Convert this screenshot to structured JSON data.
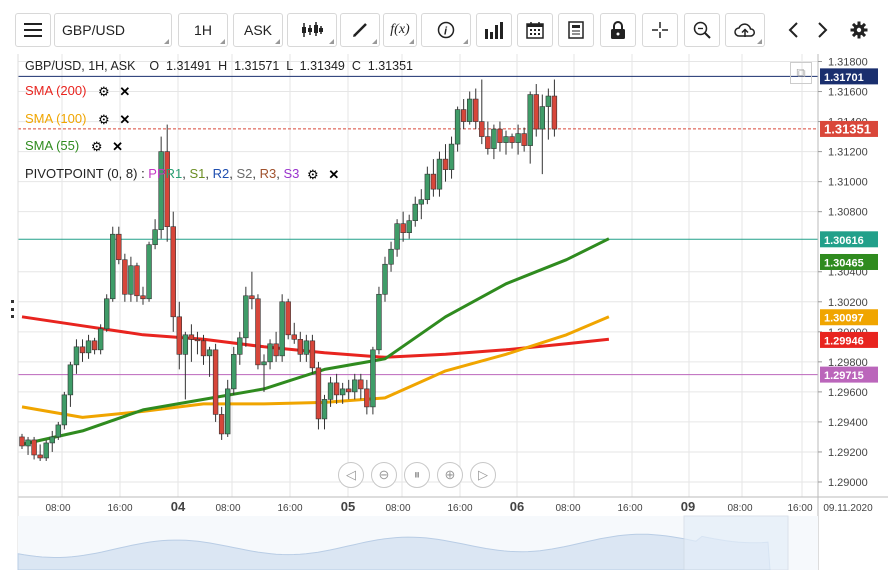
{
  "toolbar": {
    "menu_icon": "hamburger-menu-icon",
    "symbol": "GBP/USD",
    "timeframe": "1H",
    "price_type": "ASK",
    "tools": [
      "candlestick-icon",
      "draw-icon",
      "function-icon",
      "info-icon",
      "volume-bars-icon",
      "calendar-icon",
      "news-icon",
      "lock-icon",
      "crosshair-icon",
      "zoom-icon",
      "cloud-upload-icon",
      "arrow-left-icon",
      "arrow-right-icon",
      "settings-gear-icon"
    ],
    "fx_label": "f(x)"
  },
  "ohlc_header": "GBP/USD, 1H, ASK    O  1.31491  H  1.31571  L  1.31349  C  1.31351",
  "indicators": [
    {
      "label": "SMA (200)",
      "color": "#e8241f"
    },
    {
      "label": "SMA (100)",
      "color": "#f0a500"
    },
    {
      "label": "SMA (55)",
      "color": "#2f8b1f"
    }
  ],
  "pivot": {
    "label": "PIVOTPOINT (0, 8)",
    "sep": " : ",
    "parts": [
      {
        "t": "PP",
        "c": "#c438c4"
      },
      {
        "t": "R1",
        "c": "#2a9f73"
      },
      {
        "t": ", ",
        "c": "#333333"
      },
      {
        "t": "S1",
        "c": "#6b8e23"
      },
      {
        "t": ", ",
        "c": "#333333"
      },
      {
        "t": "R2",
        "c": "#1f4fb0"
      },
      {
        "t": ", ",
        "c": "#333333"
      },
      {
        "t": "S2",
        "c": "#6b6b6b"
      },
      {
        "t": ", ",
        "c": "#333333"
      },
      {
        "t": "R3",
        "c": "#a0522d"
      },
      {
        "t": ", ",
        "c": "#333333"
      },
      {
        "t": "S3",
        "c": "#9932cc"
      }
    ]
  },
  "price_axis": {
    "ticks": [
      "1.31800",
      "1.31600",
      "1.31400",
      "1.31200",
      "1.31000",
      "1.30800",
      "1.30400",
      "1.30200",
      "1.30000",
      "1.29800",
      "1.29600",
      "1.29400",
      "1.29200",
      "1.29000"
    ],
    "tick_values": [
      1.318,
      1.316,
      1.314,
      1.312,
      1.31,
      1.308,
      1.304,
      1.302,
      1.3,
      1.298,
      1.296,
      1.294,
      1.292,
      1.29
    ],
    "labels": [
      {
        "text": "1.31701",
        "value": 1.31701,
        "bg": "#1a2f6e"
      },
      {
        "text": "1.31351",
        "value": 1.31351,
        "bg": "#d9473a"
      },
      {
        "text": "1.30616",
        "value": 1.30616,
        "bg": "#22a08a"
      },
      {
        "text": "1.30465",
        "value": 1.30465,
        "bg": "#2f8b1f"
      },
      {
        "text": "1.30097",
        "value": 1.30097,
        "bg": "#f0a500"
      },
      {
        "text": "1.29946",
        "value": 1.29946,
        "bg": "#e8241f"
      },
      {
        "text": "1.29715",
        "value": 1.29715,
        "bg": "#bb66bb"
      }
    ]
  },
  "time_axis": [
    {
      "text": "08:00",
      "bold": false
    },
    {
      "text": "16:00",
      "bold": false
    },
    {
      "text": "04",
      "bold": true
    },
    {
      "text": "08:00",
      "bold": false
    },
    {
      "text": "16:00",
      "bold": false
    },
    {
      "text": "05",
      "bold": true
    },
    {
      "text": "08:00",
      "bold": false
    },
    {
      "text": "16:00",
      "bold": false
    },
    {
      "text": "06",
      "bold": true
    },
    {
      "text": "08:00",
      "bold": false
    },
    {
      "text": "16:00",
      "bold": false
    },
    {
      "text": "09",
      "bold": true
    },
    {
      "text": "08:00",
      "bold": false
    },
    {
      "text": "16:00",
      "bold": false
    },
    {
      "text": "09.11.2020",
      "bold": false
    }
  ],
  "nav_buttons": [
    "scroll-left-icon",
    "zoom-out-icon",
    "reset-zoom-icon",
    "zoom-in-icon",
    "scroll-right-icon"
  ],
  "chart_data": {
    "type": "candlestick",
    "symbol": "GBP/USD",
    "interval": "1H",
    "ylim": [
      1.289,
      1.3185
    ],
    "hlines": [
      {
        "value": 1.31701,
        "color": "#1a2f6e"
      },
      {
        "value": 1.31351,
        "color": "#d9473a"
      },
      {
        "value": 1.30616,
        "color": "#22a08a"
      },
      {
        "value": 1.29715,
        "color": "#bb66bb"
      }
    ],
    "candles": [
      [
        1.293,
        1.2932,
        1.2922,
        1.2924
      ],
      [
        1.2924,
        1.293,
        1.2918,
        1.2928
      ],
      [
        1.2928,
        1.293,
        1.2915,
        1.2918
      ],
      [
        1.2918,
        1.2925,
        1.2914,
        1.2916
      ],
      [
        1.2916,
        1.2928,
        1.2914,
        1.2926
      ],
      [
        1.2926,
        1.2934,
        1.292,
        1.293
      ],
      [
        1.293,
        1.294,
        1.2928,
        1.2938
      ],
      [
        1.2938,
        1.296,
        1.2935,
        1.2958
      ],
      [
        1.2958,
        1.298,
        1.295,
        1.2978
      ],
      [
        1.2978,
        1.2995,
        1.2972,
        1.299
      ],
      [
        1.299,
        1.2995,
        1.298,
        1.2986
      ],
      [
        1.2986,
        1.2998,
        1.2982,
        1.2994
      ],
      [
        1.2994,
        1.2996,
        1.2985,
        1.2988
      ],
      [
        1.2988,
        1.3005,
        1.2985,
        1.3002
      ],
      [
        1.3002,
        1.3025,
        1.3,
        1.3022
      ],
      [
        1.3022,
        1.307,
        1.302,
        1.3065
      ],
      [
        1.3065,
        1.307,
        1.3045,
        1.3048
      ],
      [
        1.3048,
        1.3052,
        1.302,
        1.3025
      ],
      [
        1.3025,
        1.305,
        1.302,
        1.3044
      ],
      [
        1.3044,
        1.3046,
        1.302,
        1.3024
      ],
      [
        1.3024,
        1.303,
        1.3018,
        1.3022
      ],
      [
        1.3022,
        1.306,
        1.302,
        1.3058
      ],
      [
        1.3058,
        1.3075,
        1.3055,
        1.3068
      ],
      [
        1.3068,
        1.313,
        1.3062,
        1.312
      ],
      [
        1.312,
        1.3138,
        1.306,
        1.307
      ],
      [
        1.307,
        1.308,
        1.3,
        1.301
      ],
      [
        1.301,
        1.302,
        1.2975,
        1.2985
      ],
      [
        1.2985,
        1.3,
        1.2955,
        1.2998
      ],
      [
        1.2998,
        1.3005,
        1.298,
        1.2995
      ],
      [
        1.2995,
        1.3,
        1.2985,
        1.2994
      ],
      [
        1.2994,
        1.2998,
        1.2978,
        1.2984
      ],
      [
        1.2984,
        1.299,
        1.297,
        1.2988
      ],
      [
        1.2988,
        1.2992,
        1.294,
        1.2945
      ],
      [
        1.2945,
        1.295,
        1.2928,
        1.2932
      ],
      [
        1.2932,
        1.2968,
        1.293,
        1.2962
      ],
      [
        1.2962,
        1.299,
        1.2958,
        1.2985
      ],
      [
        1.2985,
        1.3,
        1.2978,
        1.2996
      ],
      [
        1.2996,
        1.303,
        1.299,
        1.3024
      ],
      [
        1.3024,
        1.304,
        1.3015,
        1.3022
      ],
      [
        1.3022,
        1.3025,
        1.2975,
        1.2978
      ],
      [
        1.2978,
        1.2985,
        1.296,
        1.298
      ],
      [
        1.298,
        1.2995,
        1.2975,
        1.2992
      ],
      [
        1.2992,
        1.3,
        1.298,
        1.2984
      ],
      [
        1.2984,
        1.3025,
        1.298,
        1.302
      ],
      [
        1.302,
        1.3022,
        1.2995,
        1.2998
      ],
      [
        1.2998,
        1.3006,
        1.2992,
        1.2995
      ],
      [
        1.2995,
        1.3,
        1.298,
        1.2985
      ],
      [
        1.2985,
        1.2998,
        1.298,
        1.2994
      ],
      [
        1.2994,
        1.2998,
        1.2972,
        1.2976
      ],
      [
        1.2976,
        1.298,
        1.2935,
        1.2942
      ],
      [
        1.2942,
        1.2958,
        1.2935,
        1.2955
      ],
      [
        1.2955,
        1.297,
        1.295,
        1.2966
      ],
      [
        1.2966,
        1.2972,
        1.2952,
        1.2958
      ],
      [
        1.2958,
        1.2966,
        1.2952,
        1.2962
      ],
      [
        1.2962,
        1.2968,
        1.2955,
        1.296
      ],
      [
        1.296,
        1.2972,
        1.2955,
        1.2968
      ],
      [
        1.2968,
        1.2972,
        1.2955,
        1.2962
      ],
      [
        1.2962,
        1.2968,
        1.2945,
        1.295
      ],
      [
        1.295,
        1.299,
        1.2945,
        1.2988
      ],
      [
        1.2988,
        1.303,
        1.2985,
        1.3025
      ],
      [
        1.3025,
        1.305,
        1.302,
        1.3045
      ],
      [
        1.3045,
        1.306,
        1.304,
        1.3055
      ],
      [
        1.3055,
        1.3075,
        1.305,
        1.3072
      ],
      [
        1.3072,
        1.308,
        1.306,
        1.3066
      ],
      [
        1.3066,
        1.3078,
        1.3062,
        1.3074
      ],
      [
        1.3074,
        1.309,
        1.307,
        1.3085
      ],
      [
        1.3085,
        1.3095,
        1.3075,
        1.3088
      ],
      [
        1.3088,
        1.311,
        1.3085,
        1.3105
      ],
      [
        1.3105,
        1.3115,
        1.309,
        1.3095
      ],
      [
        1.3095,
        1.312,
        1.309,
        1.3115
      ],
      [
        1.3115,
        1.3125,
        1.31,
        1.3108
      ],
      [
        1.3108,
        1.313,
        1.3102,
        1.3125
      ],
      [
        1.3125,
        1.315,
        1.312,
        1.3148
      ],
      [
        1.3148,
        1.3155,
        1.3135,
        1.314
      ],
      [
        1.314,
        1.316,
        1.3138,
        1.3155
      ],
      [
        1.3155,
        1.3162,
        1.3135,
        1.314
      ],
      [
        1.314,
        1.3168,
        1.3125,
        1.313
      ],
      [
        1.313,
        1.314,
        1.3118,
        1.3122
      ],
      [
        1.3122,
        1.3138,
        1.3115,
        1.3135
      ],
      [
        1.3135,
        1.314,
        1.312,
        1.3126
      ],
      [
        1.3126,
        1.3134,
        1.3118,
        1.313
      ],
      [
        1.313,
        1.3132,
        1.3122,
        1.3126
      ],
      [
        1.3126,
        1.3138,
        1.3118,
        1.3132
      ],
      [
        1.3132,
        1.3136,
        1.312,
        1.3124
      ],
      [
        1.3124,
        1.316,
        1.3112,
        1.3158
      ],
      [
        1.3158,
        1.3165,
        1.313,
        1.3135
      ],
      [
        1.3135,
        1.3158,
        1.3105,
        1.315
      ],
      [
        1.315,
        1.3162,
        1.3128,
        1.3157
      ],
      [
        1.3157,
        1.3168,
        1.313,
        1.3135
      ]
    ],
    "sma_55": [
      [
        0,
        1.2925
      ],
      [
        10,
        1.2934
      ],
      [
        20,
        1.2948
      ],
      [
        30,
        1.2955
      ],
      [
        40,
        1.2962
      ],
      [
        50,
        1.2975
      ],
      [
        60,
        1.2982
      ],
      [
        70,
        1.301
      ],
      [
        80,
        1.3032
      ],
      [
        85,
        1.304
      ],
      [
        90,
        1.3048
      ],
      [
        97,
        1.3062
      ]
    ],
    "sma_100": [
      [
        0,
        1.295
      ],
      [
        10,
        1.2943
      ],
      [
        20,
        1.2947
      ],
      [
        30,
        1.2952
      ],
      [
        40,
        1.2952
      ],
      [
        50,
        1.2953
      ],
      [
        60,
        1.2956
      ],
      [
        70,
        1.2974
      ],
      [
        80,
        1.2985
      ],
      [
        90,
        1.2998
      ],
      [
        97,
        1.301
      ]
    ],
    "sma_200": [
      [
        0,
        1.301
      ],
      [
        10,
        1.3004
      ],
      [
        20,
        1.2998
      ],
      [
        30,
        1.2995
      ],
      [
        40,
        1.299
      ],
      [
        50,
        1.2986
      ],
      [
        60,
        1.2983
      ],
      [
        70,
        1.2985
      ],
      [
        80,
        1.2988
      ],
      [
        90,
        1.2992
      ],
      [
        97,
        1.2995
      ]
    ]
  }
}
